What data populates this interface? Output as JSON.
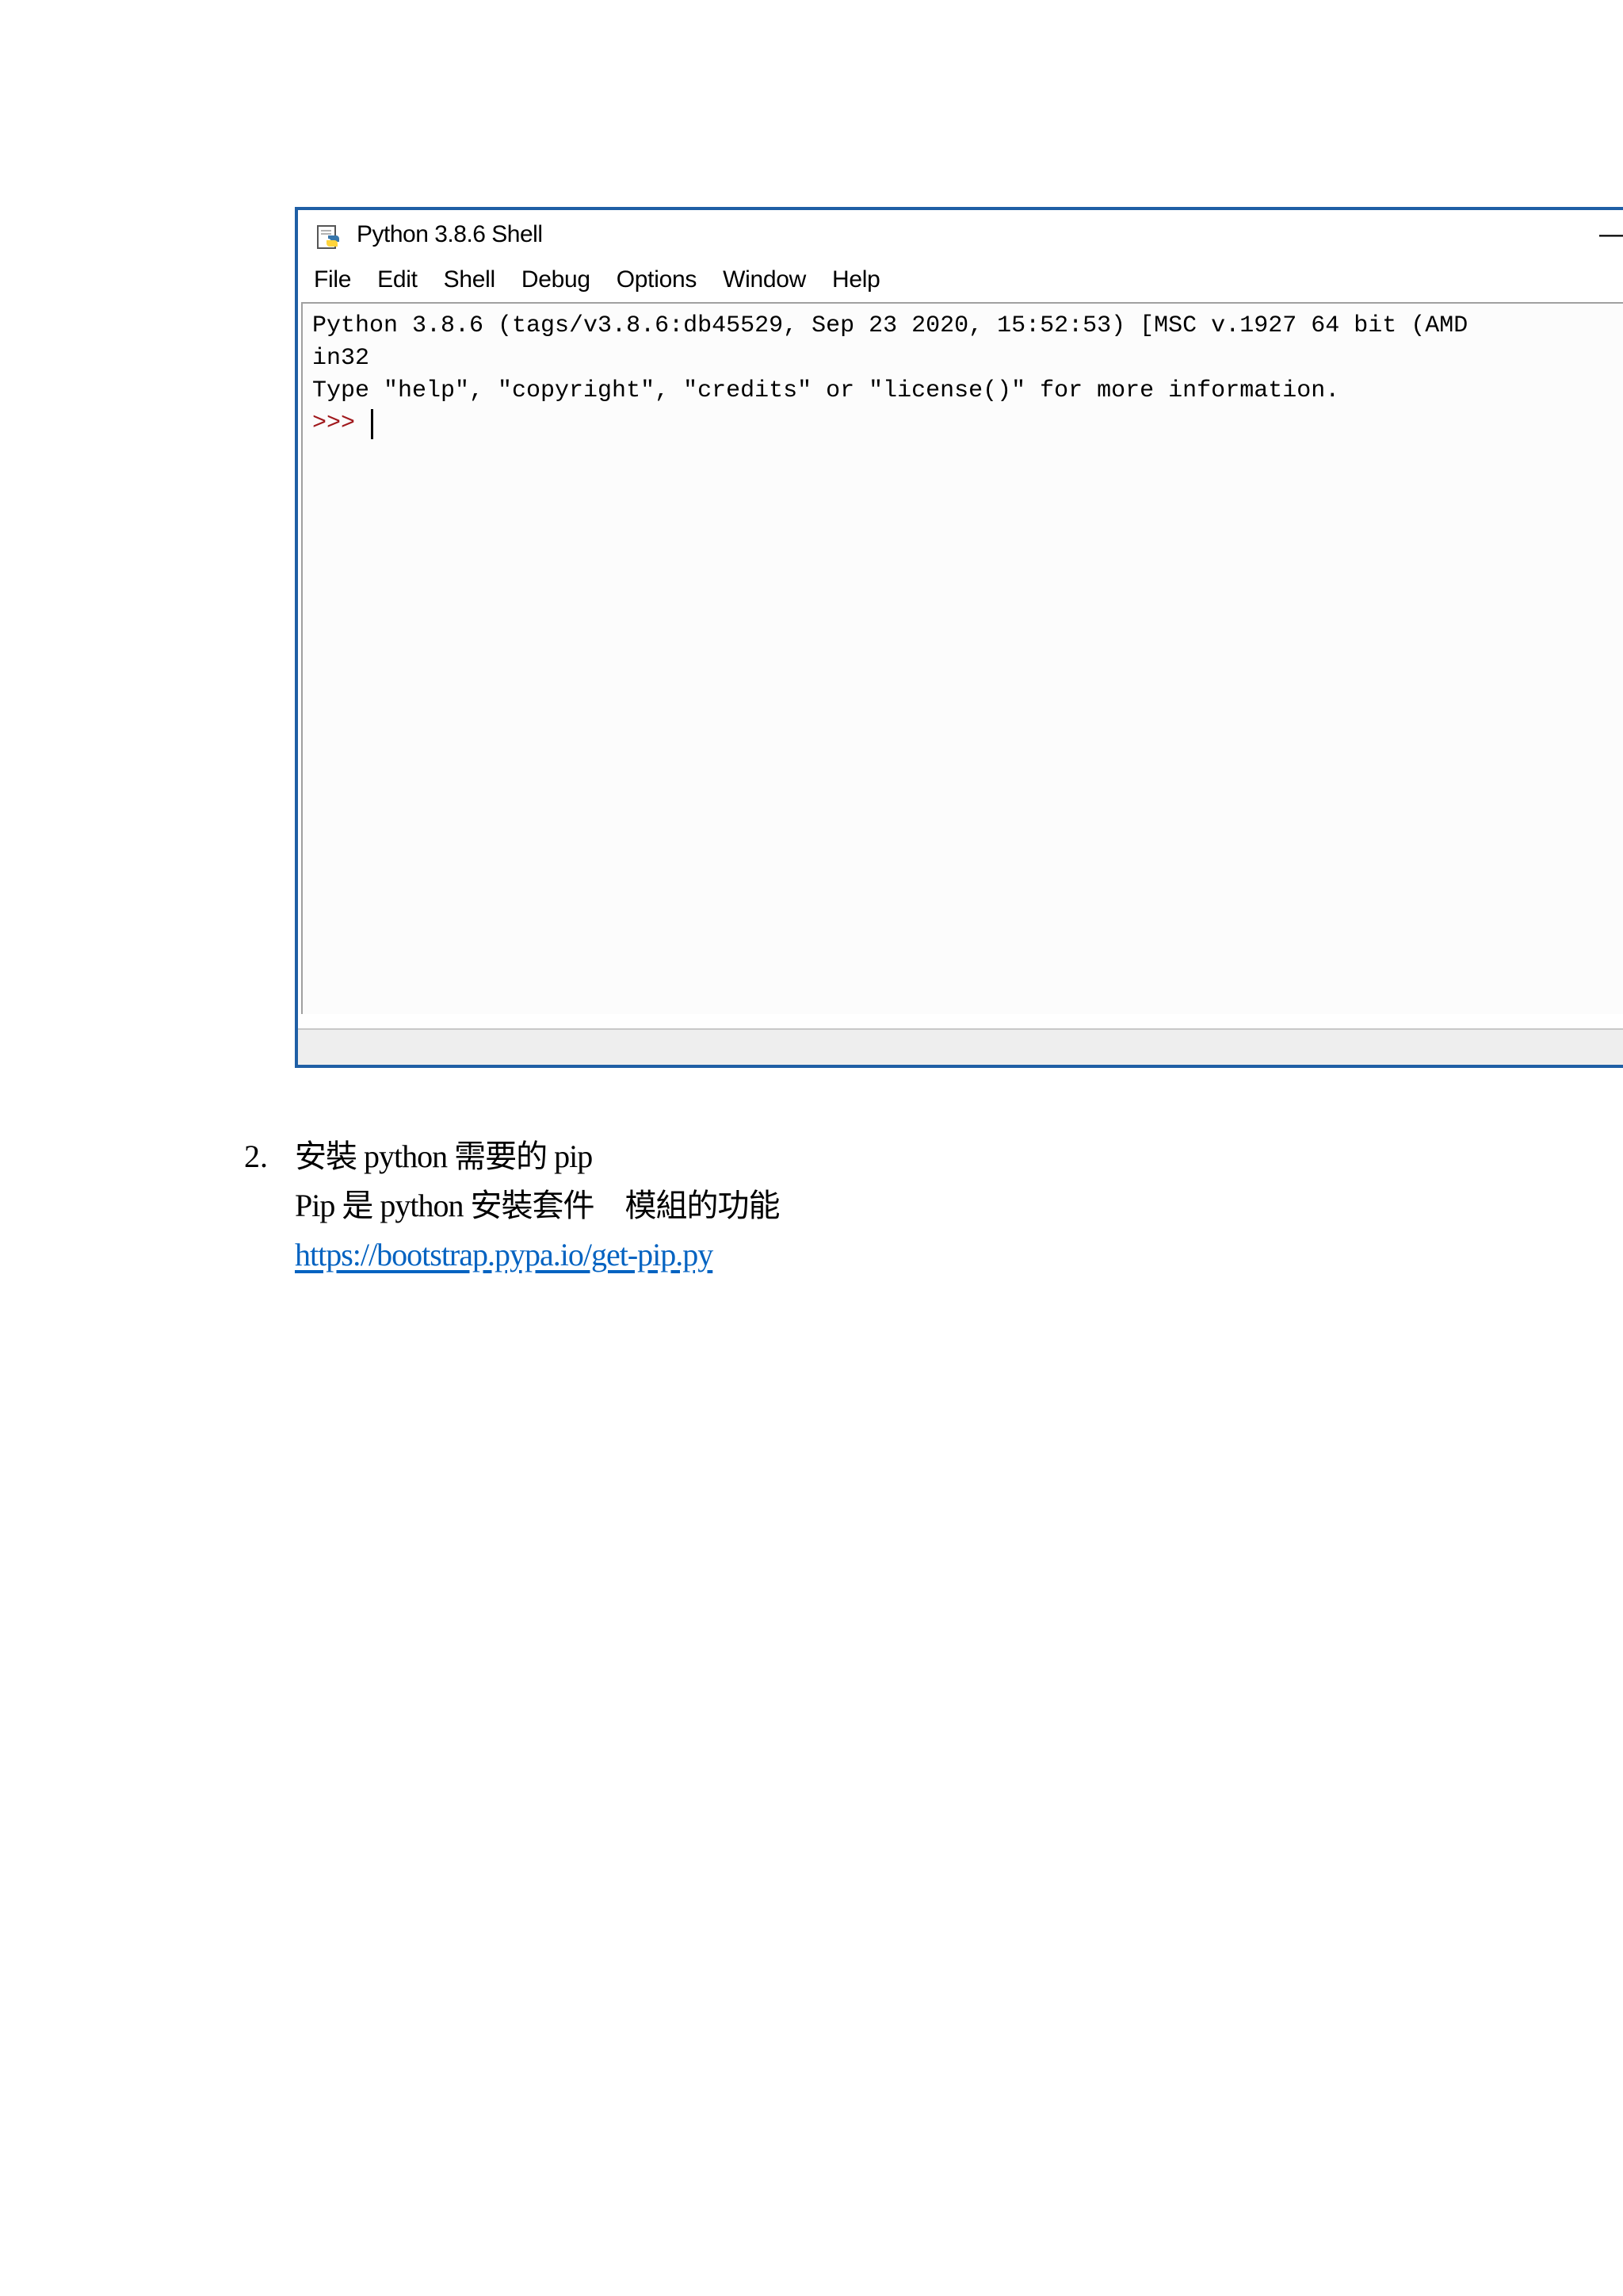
{
  "shell": {
    "title": "Python 3.8.6 Shell",
    "minimize_symbol": "—",
    "menu": [
      "File",
      "Edit",
      "Shell",
      "Debug",
      "Options",
      "Window",
      "Help"
    ],
    "output_lines": [
      "Python 3.8.6 (tags/v3.8.6:db45529, Sep 23 2020, 15:52:53) [MSC v.1927 64 bit (AMD",
      "in32",
      "Type \"help\", \"copyright\", \"credits\" or \"license()\" for more information."
    ],
    "prompt": ">>> ",
    "prompt_color": "#a0181c",
    "window_border_color": "#1f5fa5"
  },
  "document": {
    "item_number": "2.",
    "lines": [
      "安裝 python 需要的 pip",
      "Pip 是 python 安裝套件　模組的功能"
    ],
    "link": {
      "text": "https://bootstrap.pypa.io/get-pip.py",
      "color": "#0563c1"
    }
  }
}
